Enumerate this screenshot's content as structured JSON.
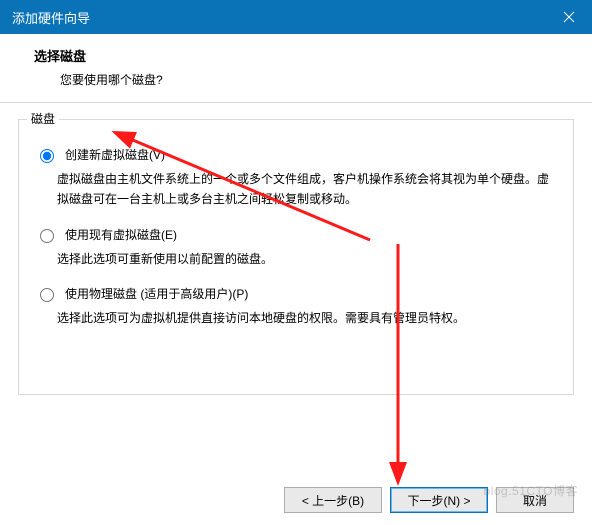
{
  "window": {
    "title": "添加硬件向导"
  },
  "header": {
    "title": "选择磁盘",
    "subtitle": "您要使用哪个磁盘?"
  },
  "group": {
    "legend": "磁盘",
    "options": [
      {
        "label": "创建新虚拟磁盘(V)",
        "desc": "虚拟磁盘由主机文件系统上的一个或多个文件组成，客户机操作系统会将其视为单个硬盘。虚拟磁盘可在一台主机上或多台主机之间轻松复制或移动。",
        "checked": true
      },
      {
        "label": "使用现有虚拟磁盘(E)",
        "desc": "选择此选项可重新使用以前配置的磁盘。",
        "checked": false
      },
      {
        "label": "使用物理磁盘 (适用于高级用户)(P)",
        "desc": "选择此选项可为虚拟机提供直接访问本地硬盘的权限。需要具有管理员特权。",
        "checked": false
      }
    ]
  },
  "footer": {
    "back": "< 上一步(B)",
    "next": "下一步(N) >",
    "cancel": "取消"
  },
  "watermark": "blog.51CTO博客"
}
